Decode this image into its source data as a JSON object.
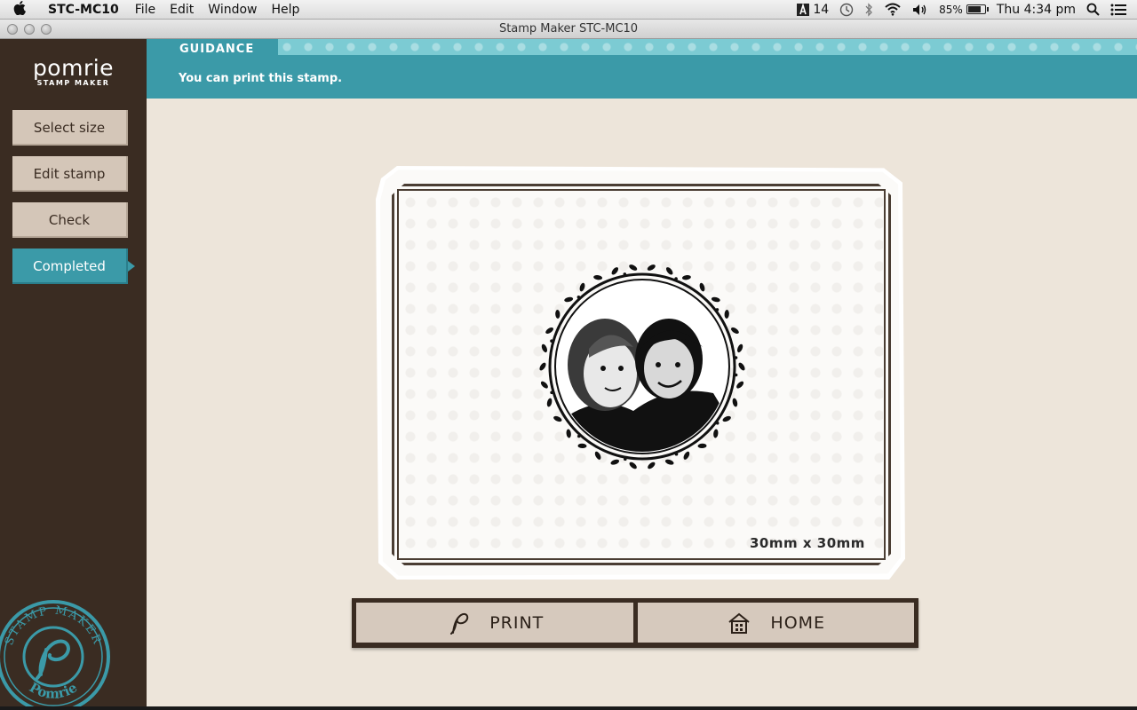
{
  "menubar": {
    "app_name": "STC-MC10",
    "menus": [
      "File",
      "Edit",
      "Window",
      "Help"
    ],
    "adobe_count": "14",
    "battery": "85%",
    "battery_level": 0.85,
    "clock": "Thu 4:34 pm"
  },
  "window": {
    "title": "Stamp Maker STC-MC10"
  },
  "sidebar": {
    "brand": "pomrie",
    "brand_sub": "STAMP MAKER",
    "steps": [
      {
        "label": "Select size",
        "active": false
      },
      {
        "label": "Edit stamp",
        "active": false
      },
      {
        "label": "Check",
        "active": false
      },
      {
        "label": "Completed",
        "active": true
      }
    ],
    "seal": {
      "top_text": "STAMP MAKER",
      "bottom_text": "Pomrie"
    }
  },
  "guidance": {
    "tab_label": "GUIDANCE",
    "message": "You can print this stamp."
  },
  "preview": {
    "size_label": "30mm x 30mm"
  },
  "actions": {
    "print_label": "PRINT",
    "home_label": "HOME"
  },
  "colors": {
    "accent": "#3b9aa8",
    "sidebar": "#3a2c22",
    "button": "#d6c9bd",
    "background": "#ede5da"
  }
}
